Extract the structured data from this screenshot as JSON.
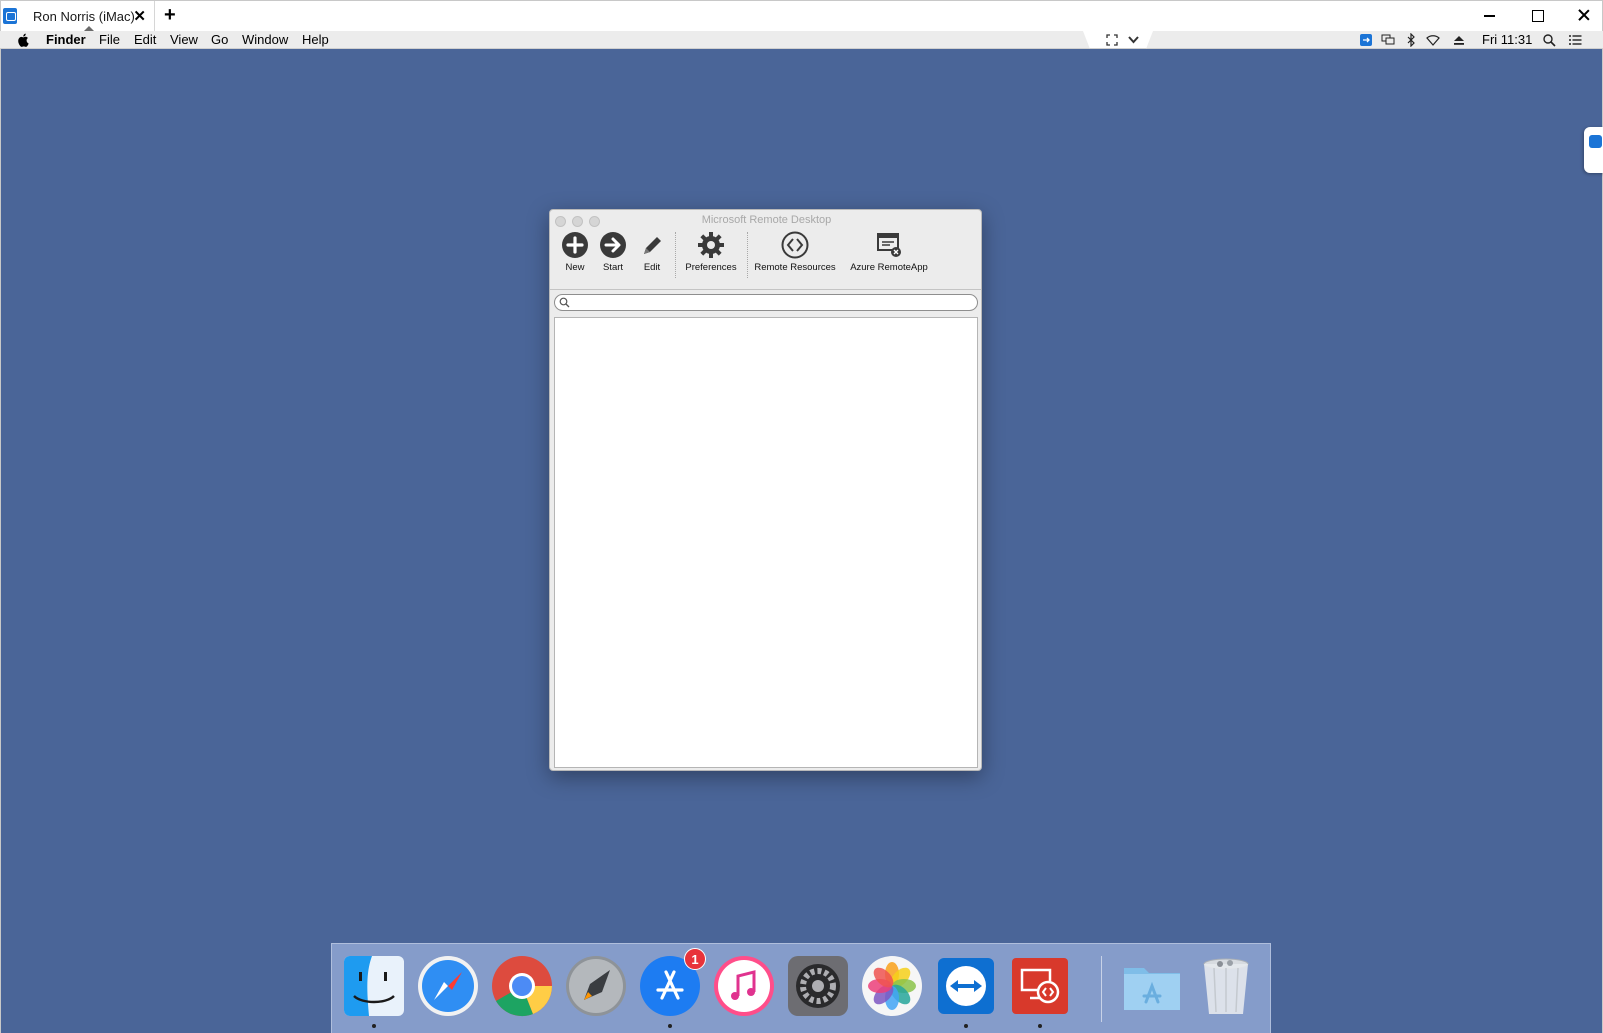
{
  "teamviewer": {
    "tab_label": "Ron Norris (iMac)",
    "close_glyph": "✕",
    "add_tab_glyph": "+"
  },
  "menubar": {
    "app_name": "Finder",
    "items": [
      "File",
      "Edit",
      "View",
      "Go",
      "Window",
      "Help"
    ],
    "clock": "Fri 11:31",
    "status_icons": [
      "teamviewer-icon",
      "display-mirror-icon",
      "bluetooth-icon",
      "wifi-icon",
      "eject-icon",
      "spotlight-search-icon",
      "notification-center-icon"
    ]
  },
  "window": {
    "title": "Microsoft Remote Desktop",
    "toolbar": {
      "new_label": "New",
      "start_label": "Start",
      "edit_label": "Edit",
      "preferences_label": "Preferences",
      "remote_resources_label": "Remote Resources",
      "azure_remoteapp_label": "Azure RemoteApp"
    },
    "search": {
      "value": "",
      "placeholder": ""
    }
  },
  "dock": {
    "items": [
      {
        "name": "finder",
        "running": true
      },
      {
        "name": "safari",
        "running": false
      },
      {
        "name": "chrome",
        "running": false
      },
      {
        "name": "launchpad",
        "running": false
      },
      {
        "name": "app-store",
        "running": true,
        "badge": "1"
      },
      {
        "name": "itunes",
        "running": false
      },
      {
        "name": "system-preferences",
        "running": false
      },
      {
        "name": "photos",
        "running": false
      },
      {
        "name": "teamviewer",
        "running": true
      },
      {
        "name": "microsoft-remote-desktop",
        "running": true
      },
      {
        "name": "applications-folder",
        "running": false
      },
      {
        "name": "trash",
        "running": false
      }
    ]
  },
  "colors": {
    "desktop_bg": "#4a6598",
    "dock_bg": "#8fa6d2",
    "teamviewer_blue": "#1b74d6",
    "badge_red": "#e8333a"
  }
}
